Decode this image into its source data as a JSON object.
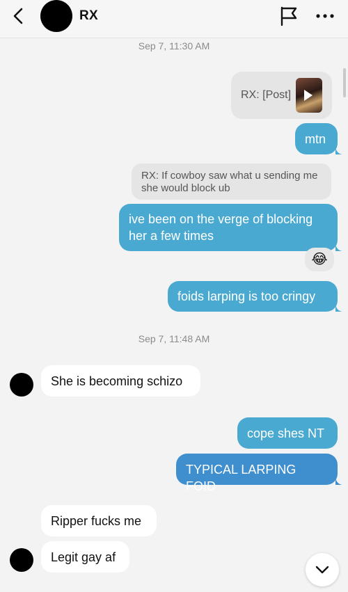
{
  "header": {
    "contact_name": "RX"
  },
  "timestamps": [
    "Sep 7, 11:30 AM",
    "Sep 7, 11:48 AM"
  ],
  "messages": {
    "shared_post": "RX: [Post]",
    "mtn": "mtn",
    "quote": "RX: If cowboy saw what u sending me she would block ub",
    "verge": "ive been on the verge of blocking her a few times",
    "reaction": "😂",
    "larping": "foids larping is too cringy",
    "schizo": "She is becoming schizo",
    "cope": "cope shes NT",
    "typical": "TYPICAL LARPING FOID",
    "ripper": "Ripper fucks me",
    "legit": "Legit gay af"
  },
  "colors": {
    "outgoing_bubble": "#4aa9d0",
    "outgoing_bubble_alt": "#3f8fcf",
    "incoming_bubble": "#ffffff",
    "quote_bubble": "#e5e5e5",
    "background": "#f3f3f3"
  },
  "icons": {
    "back": "chevron-left-icon",
    "report": "flag-icon",
    "more": "more-horizontal-icon",
    "scroll_down": "chevron-down-icon",
    "play": "play-icon"
  }
}
